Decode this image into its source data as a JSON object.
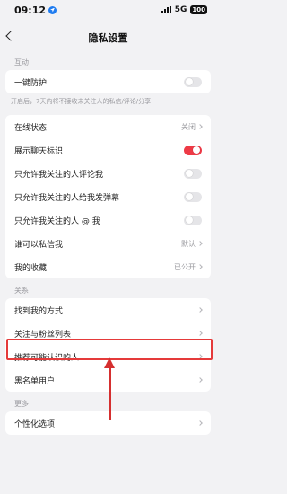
{
  "status": {
    "time": "09:12",
    "network": "5G",
    "battery": "100"
  },
  "nav": {
    "title": "隐私设置"
  },
  "sections": {
    "interaction": {
      "header": "互动",
      "one_click": "一键防护",
      "note": "开启后，7天内将不接收未关注人的私信/评论/分享"
    },
    "general": {
      "online_status": {
        "label": "在线状态",
        "value": "关闭"
      },
      "show_chat_mark": {
        "label": "展示聊天标识",
        "on": true
      },
      "only_follow_comment": {
        "label": "只允许我关注的人评论我",
        "on": false
      },
      "only_follow_danmu": {
        "label": "只允许我关注的人给我发弹幕",
        "on": false
      },
      "only_follow_at": {
        "label": "只允许我关注的人 @ 我",
        "on": false
      },
      "who_can_dm": {
        "label": "谁可以私信我",
        "value": "默认"
      },
      "my_favorites": {
        "label": "我的收藏",
        "value": "已公开"
      }
    },
    "relation": {
      "header": "关系",
      "find_me": "找到我的方式",
      "follow_fans": "关注与粉丝列表",
      "recommend": "推荐可能认识的人",
      "blacklist": "黑名单用户"
    },
    "more": {
      "header": "更多",
      "personalize": "个性化选项"
    }
  },
  "colors": {
    "accent_red": "#ee3a46",
    "highlight": "#e53a3a"
  }
}
